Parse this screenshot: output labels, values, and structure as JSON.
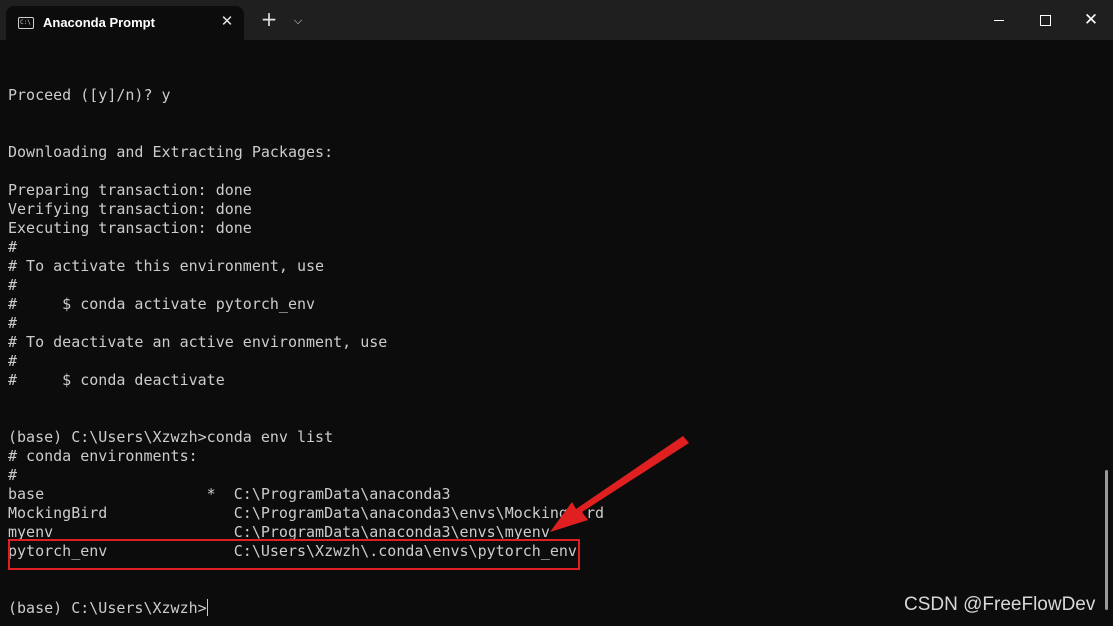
{
  "window": {
    "tab_title": "Anaconda Prompt",
    "tab_icon": "terminal-icon",
    "tab_close": "✕",
    "new_tab": "+",
    "dropdown": "⌄",
    "close": "✕"
  },
  "terminal": {
    "lines": [
      "Proceed ([y]/n)? y",
      "",
      "",
      "Downloading and Extracting Packages:",
      "",
      "Preparing transaction: done",
      "Verifying transaction: done",
      "Executing transaction: done",
      "#",
      "# To activate this environment, use",
      "#",
      "#     $ conda activate pytorch_env",
      "#",
      "# To deactivate an active environment, use",
      "#",
      "#     $ conda deactivate",
      "",
      "",
      "(base) C:\\Users\\Xzwzh>conda env list",
      "# conda environments:",
      "#",
      "base                  *  C:\\ProgramData\\anaconda3",
      "MockingBird              C:\\ProgramData\\anaconda3\\envs\\MockingBird",
      "myenv                    C:\\ProgramData\\anaconda3\\envs\\myenv",
      "pytorch_env              C:\\Users\\Xzwzh\\.conda\\envs\\pytorch_env",
      "",
      "",
      "(base) C:\\Users\\Xzwzh>"
    ]
  },
  "annotation": {
    "highlight_color": "#e02020"
  },
  "watermark": "CSDN @FreeFlowDev"
}
